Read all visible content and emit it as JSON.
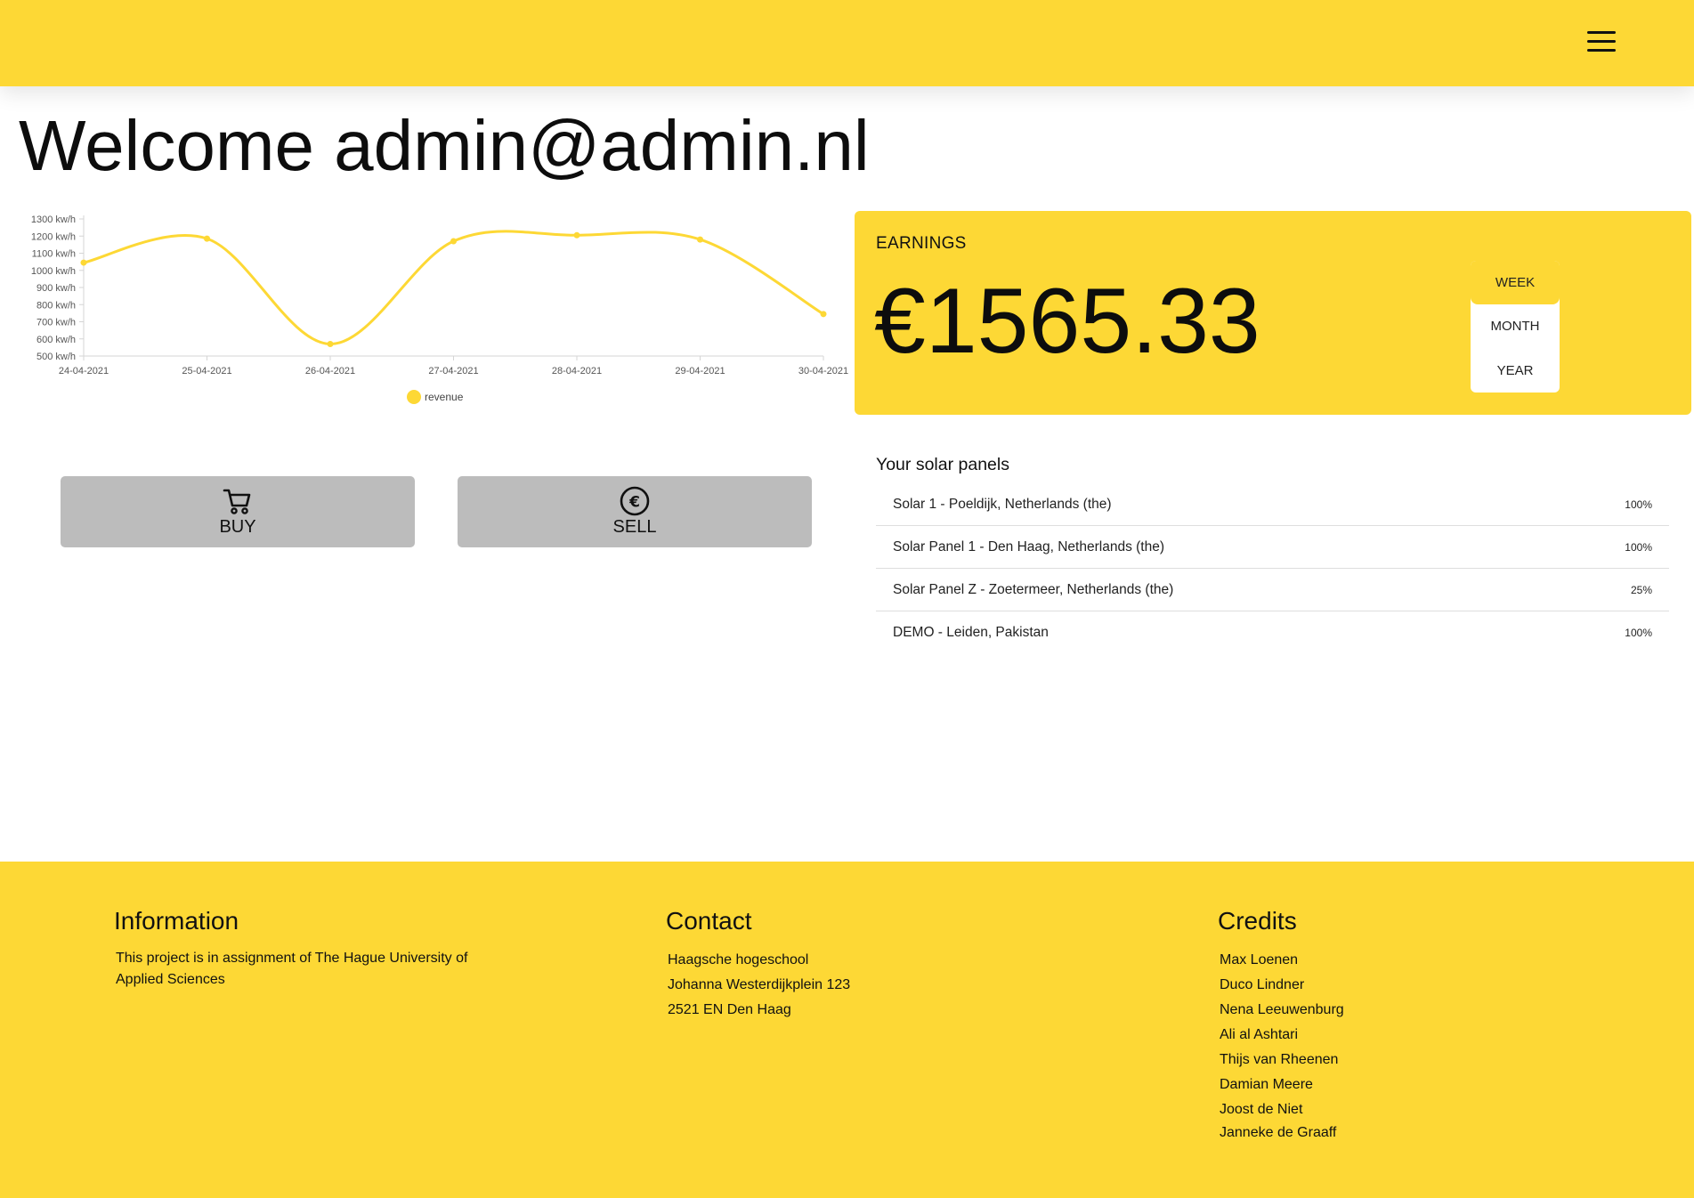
{
  "header": {
    "menu_icon": "hamburger-menu-icon"
  },
  "welcome": {
    "text": "Welcome admin@admin.nl"
  },
  "chart_data": {
    "type": "line",
    "categories": [
      "24-04-2021",
      "25-04-2021",
      "26-04-2021",
      "27-04-2021",
      "28-04-2021",
      "29-04-2021",
      "30-04-2021"
    ],
    "series": [
      {
        "name": "revenue",
        "values": [
          1045,
          1185,
          570,
          1170,
          1205,
          1180,
          745
        ],
        "color": "#fdd835"
      }
    ],
    "y_ticks": [
      "500 kw/h",
      "600 kw/h",
      "700 kw/h",
      "800 kw/h",
      "900 kw/h",
      "1000 kw/h",
      "1100 kw/h",
      "1200 kw/h",
      "1300 kw/h"
    ],
    "ylim": [
      500,
      1300
    ],
    "legend_position": "bottom",
    "grid": false,
    "title": "",
    "xlabel": "",
    "ylabel": ""
  },
  "actions": {
    "buy": {
      "label": "BUY",
      "icon": "shopping-cart-icon"
    },
    "sell": {
      "label": "SELL",
      "icon": "euro-coin-icon"
    }
  },
  "earnings": {
    "title": "EARNINGS",
    "amount": "€1565.33",
    "periods": [
      {
        "label": "WEEK",
        "active": true
      },
      {
        "label": "MONTH",
        "active": false
      },
      {
        "label": "YEAR",
        "active": false
      }
    ]
  },
  "panels": {
    "title": "Your solar panels",
    "items": [
      {
        "name": "Solar 1 - Poeldijk, Netherlands (the)",
        "percent": "100%"
      },
      {
        "name": "Solar Panel 1 - Den Haag, Netherlands (the)",
        "percent": "100%"
      },
      {
        "name": "Solar Panel Z - Zoetermeer, Netherlands (the)",
        "percent": "25%"
      },
      {
        "name": "DEMO - Leiden, Pakistan",
        "percent": "100%"
      }
    ]
  },
  "footer": {
    "information": {
      "title": "Information",
      "text": "This project is in assignment of The Hague University of Applied Sciences"
    },
    "contact": {
      "title": "Contact",
      "lines": [
        "Haagsche hogeschool",
        "Johanna Westerdijkplein 123",
        "2521 EN Den Haag"
      ]
    },
    "credits": {
      "title": "Credits",
      "names": [
        "Max Loenen",
        "Duco Lindner",
        "Nena Leeuwenburg",
        "Ali al Ashtari",
        "Thijs van Rheenen",
        "Damian Meere",
        "Joost de Niet",
        "Janneke de Graaff"
      ]
    }
  }
}
